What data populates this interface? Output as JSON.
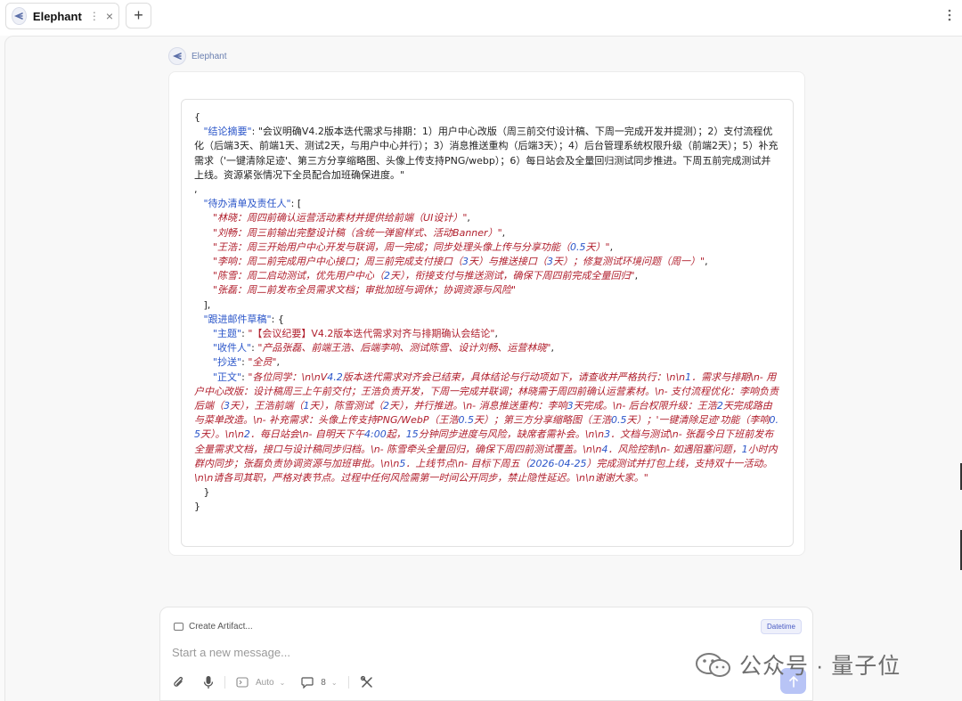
{
  "tab": {
    "title": "Elephant",
    "dots": "⋮",
    "close": "×"
  },
  "new_tab": {
    "label": "+"
  },
  "window_menu": {
    "icon": "more-vertical-icon"
  },
  "agent": {
    "name": "Elephant"
  },
  "code_lines": [
    [
      [
        "p",
        "{"
      ]
    ],
    [
      [
        "p",
        "   "
      ],
      [
        "k",
        "\"结论摘要\""
      ],
      [
        "p",
        ": \"会议明确V4.2版本迭代需求与排期：1）用户中心改版（周三前交付设计稿、下周一完成开发并提测）；2）支付流程优化（后端3天、前端1天、测试2天，与用户中心并行）；3）消息推送重构（后端3天）；4）后台管理系统权限升级（前端2天）；5）补充需求（'一键清除足迹'、第三方分享缩略图、头像上传支持PNG/webp）；6）每日站会及全量回归测试同步推进。下周五前完成测试并上线。资源紧张情况下全员配合加班确保进度。\""
      ]
    ],
    [
      [
        "p",
        ","
      ]
    ],
    [
      [
        "p",
        "   "
      ],
      [
        "k",
        "\"待办清单及责任人\""
      ],
      [
        "p",
        ": ["
      ]
    ],
    [
      [
        "p",
        "      "
      ],
      [
        "si",
        "\"林晓：周四前确认运营活动素材并提供给前端（UI设计）\""
      ],
      [
        "p",
        ","
      ]
    ],
    [
      [
        "p",
        "      "
      ],
      [
        "si",
        "\"刘畅：周三前输出完整设计稿（含统一弹窗样式、活动Banner）\""
      ],
      [
        "p",
        ","
      ]
    ],
    [
      [
        "p",
        "      "
      ],
      [
        "si",
        "\"王浩：周三开始用户中心开发与联调，周一完成；同步处理头像上传与分享功能（"
      ],
      [
        "n",
        "0.5"
      ],
      [
        "si",
        "天）\""
      ],
      [
        "p",
        ","
      ]
    ],
    [
      [
        "p",
        "      "
      ],
      [
        "si",
        "\"李响：周二前完成用户中心接口；周三前完成支付接口（"
      ],
      [
        "n",
        "3"
      ],
      [
        "si",
        "天）与推送接口（"
      ],
      [
        "n",
        "3"
      ],
      [
        "si",
        "天）；修复测试环境问题（周一）\""
      ],
      [
        "p",
        ","
      ]
    ],
    [
      [
        "p",
        "      "
      ],
      [
        "si",
        "\"陈雪：周二启动测试，优先用户中心（"
      ],
      [
        "n",
        "2"
      ],
      [
        "si",
        "天），衔接支付与推送测试，确保下周四前完成全量回归\""
      ],
      [
        "p",
        ","
      ]
    ],
    [
      [
        "p",
        "      "
      ],
      [
        "si",
        "\"张磊：周二前发布全员需求文档；审批加班与调休；协调资源与风险\""
      ]
    ],
    [
      [
        "p",
        "   ],"
      ]
    ],
    [
      [
        "p",
        "   "
      ],
      [
        "k",
        "\"跟进邮件草稿\""
      ],
      [
        "p",
        ": {"
      ]
    ],
    [
      [
        "p",
        "      "
      ],
      [
        "k",
        "\"主题\""
      ],
      [
        "p",
        ": "
      ],
      [
        "s",
        "\"【会议纪要】V4.2版本迭代需求对齐与排期确认会结论\""
      ],
      [
        "p",
        ","
      ]
    ],
    [
      [
        "p",
        "      "
      ],
      [
        "k",
        "\"收件人\""
      ],
      [
        "p",
        ": "
      ],
      [
        "si",
        "\"产品张磊、前端王浩、后端李响、测试陈雪、设计刘畅、运营林晓\""
      ],
      [
        "p",
        ","
      ]
    ],
    [
      [
        "p",
        "      "
      ],
      [
        "k",
        "\"抄送\""
      ],
      [
        "p",
        ": "
      ],
      [
        "si",
        "\"全员\""
      ],
      [
        "p",
        ","
      ]
    ],
    [
      [
        "p",
        "      "
      ],
      [
        "k",
        "\"正文\""
      ],
      [
        "p",
        ": "
      ],
      [
        "si",
        "\"各位同学：\\n\\nV"
      ],
      [
        "n",
        "4.2"
      ],
      [
        "si",
        "版本迭代需求对齐会已结束，具体结论与行动项如下，请查收并严格执行：\\n\\n"
      ],
      [
        "n",
        "1"
      ],
      [
        "si",
        "．需求与排期\\n- 用户中心改版：设计稿周三上午前交付；王浩负责开发，下周一完成并联调；林晓需于周四前确认运营素材。\\n- 支付流程优化：李响负责后端（"
      ],
      [
        "n",
        "3"
      ],
      [
        "si",
        "天），王浩前端（"
      ],
      [
        "n",
        "1"
      ],
      [
        "si",
        "天），陈雪测试（"
      ],
      [
        "n",
        "2"
      ],
      [
        "si",
        "天），并行推进。\\n- 消息推送重构：李响"
      ],
      [
        "n",
        "3"
      ],
      [
        "si",
        "天完成。\\n- 后台权限升级：王浩"
      ],
      [
        "n",
        "2"
      ],
      [
        "si",
        "天完成路由与菜单改造。\\n- 补充需求：头像上传支持PNG/WebP（王浩"
      ],
      [
        "n",
        "0.5"
      ],
      [
        "si",
        "天）；第三方分享缩略图（王浩"
      ],
      [
        "n",
        "0.5"
      ],
      [
        "si",
        "天）；'一键清除足迹'功能（李响"
      ],
      [
        "n",
        "0.5"
      ],
      [
        "si",
        "天）。\\n\\n"
      ],
      [
        "n",
        "2"
      ],
      [
        "si",
        "．每日站会\\n- 自明天下午"
      ],
      [
        "n",
        "4:00"
      ],
      [
        "si",
        "起，"
      ],
      [
        "n",
        "15"
      ],
      [
        "si",
        "分钟同步进度与风险，缺席者需补会。\\n\\n"
      ],
      [
        "n",
        "3"
      ],
      [
        "si",
        "．文档与测试\\n- 张磊今日下班前发布全量需求文档，接口与设计稿同步归档。\\n- 陈雪牵头全量回归，确保下周四前测试覆盖。\\n\\n"
      ],
      [
        "n",
        "4"
      ],
      [
        "si",
        "．风险控制\\n- 如遇阻塞问题，"
      ],
      [
        "n",
        "1"
      ],
      [
        "si",
        "小时内群内同步；张磊负责协调资源与加班审批。\\n\\n"
      ],
      [
        "n",
        "5"
      ],
      [
        "si",
        "．上线节点\\n- 目标下周五（"
      ],
      [
        "n",
        "2026-04-25"
      ],
      [
        "si",
        "）完成测试并打包上线，支持双十一活动。\\n\\n请各司其职，严格对表节点。过程中任何风险需第一时间公开同步，禁止隐性延迟。\\n\\n谢谢大家。\""
      ]
    ],
    [
      [
        "p",
        "   }"
      ]
    ],
    [
      [
        "p",
        "}"
      ]
    ]
  ],
  "composer": {
    "artifact_label": "Create Artifact...",
    "datetime_badge": "Datetime",
    "placeholder": "Start a new message...",
    "model_label": "Auto",
    "context_count": "8",
    "send_icon": "arrow-up-icon"
  },
  "watermark": {
    "text": "公众号 · 量子位"
  }
}
